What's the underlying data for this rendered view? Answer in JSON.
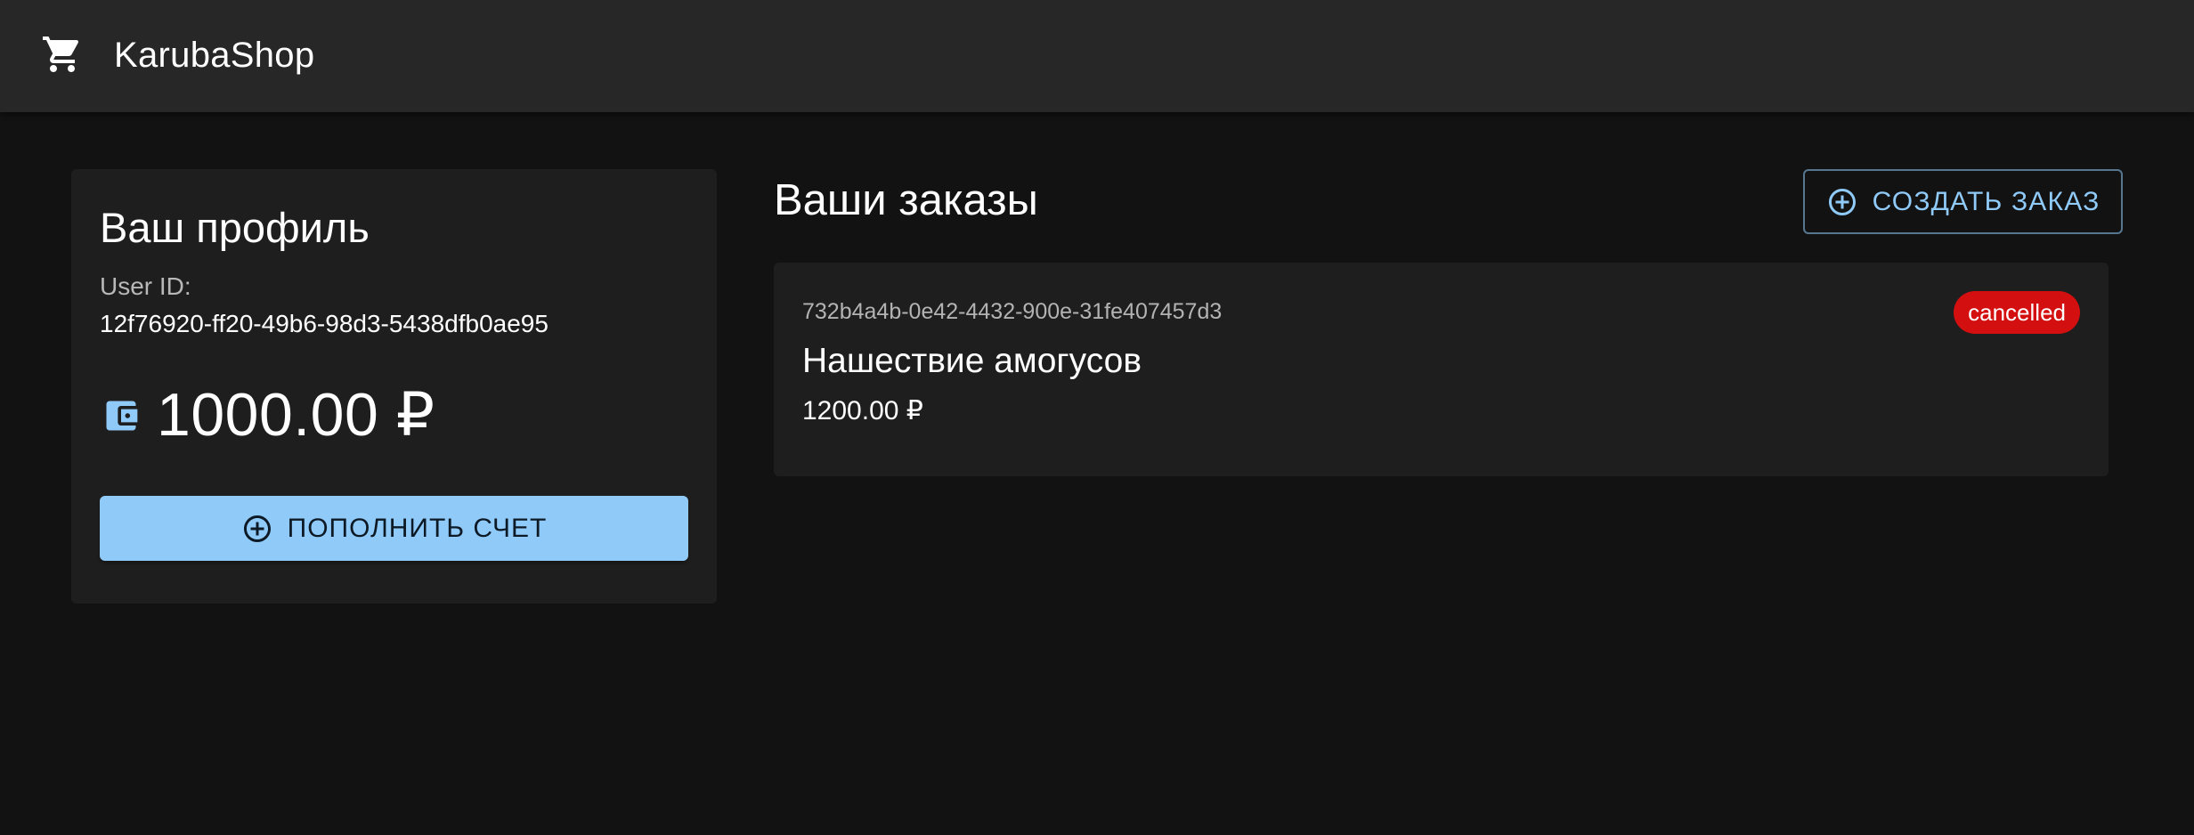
{
  "header": {
    "brand": "KarubaShop",
    "cart_icon": "shopping-cart-icon"
  },
  "profile": {
    "title": "Ваш профиль",
    "user_id_label": "User ID:",
    "user_id": "12f76920-ff20-49b6-98d3-5438dfb0ae95",
    "wallet_icon": "wallet-icon",
    "balance": "1000.00 ₽",
    "topup_label": "ПОПОЛНИТЬ СЧЕТ"
  },
  "orders": {
    "title": "Ваши заказы",
    "create_label": "СОЗДАТЬ ЗАКАЗ",
    "items": [
      {
        "id": "732b4a4b-0e42-4432-900e-31fe407457d3",
        "name": "Нашествие амогусов",
        "price": "1200.00 ₽",
        "status": "cancelled"
      }
    ]
  },
  "colors": {
    "background": "#121212",
    "appbar": "#272727",
    "card": "#1e1e1e",
    "accent": "#90caf9",
    "status_cancelled": "#d40f0f"
  }
}
